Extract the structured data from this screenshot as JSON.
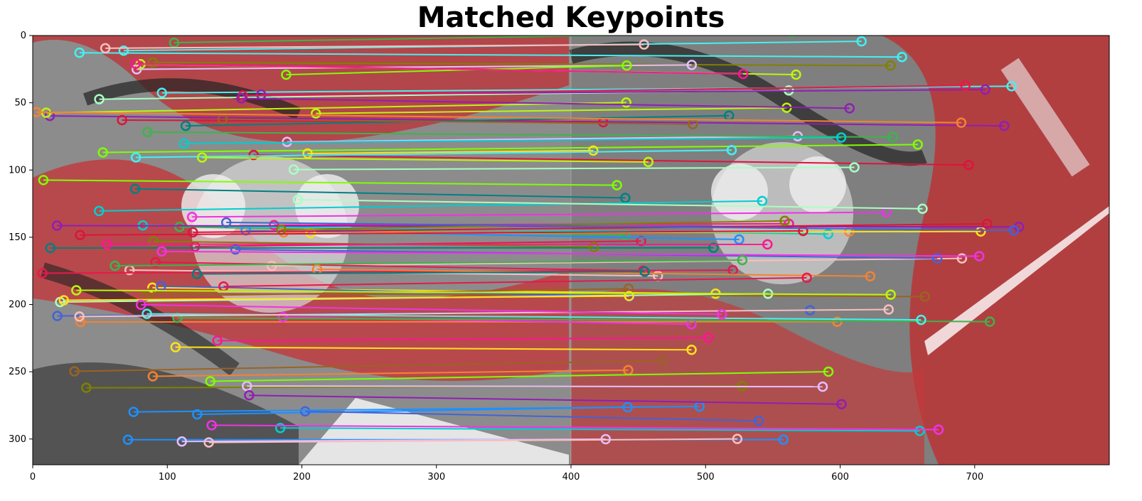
{
  "title": "Matched Keypoints",
  "x_ticks": [
    "0",
    "100",
    "200",
    "300",
    "400",
    "500",
    "600",
    "700"
  ],
  "y_ticks": [
    "0",
    "50",
    "100",
    "150",
    "200",
    "250",
    "300"
  ],
  "image": {
    "description_free": true,
    "split_x": 400
  },
  "colors": {
    "bg_red": "#c23a3a",
    "bg_gray": "#8a8a8a",
    "accent": "#2a2a2a"
  }
}
